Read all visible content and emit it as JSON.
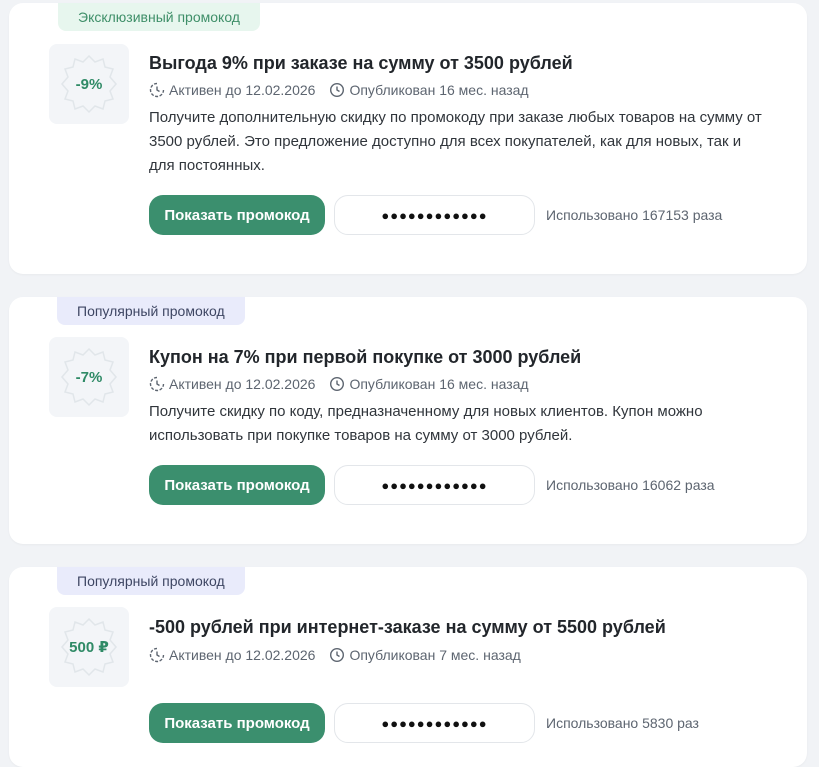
{
  "promos": [
    {
      "badge": "Эксклюзивный промокод",
      "badge_type": "exclusive",
      "discount": "-9%",
      "title": "Выгода 9% при заказе на сумму от 3500 рублей",
      "active": "Активен до 12.02.2026",
      "published": "Опубликован 16 мес. назад",
      "description": "Получите дополнительную скидку по промокоду при заказе любых товаров на сумму от 3500 рублей. Это предложение доступно для всех покупателей, как для новых, так и для постоянных.",
      "button": "Показать промокод",
      "code_mask": "●●●●●●●●●●●●",
      "used": "Использовано 167153 раза"
    },
    {
      "badge": "Популярный промокод",
      "badge_type": "popular",
      "discount": "-7%",
      "title": "Купон на 7% при первой покупке от 3000 рублей",
      "active": "Активен до 12.02.2026",
      "published": "Опубликован 16 мес. назад",
      "description": "Получите скидку по коду, предназначенному для новых клиентов. Купон можно использовать при покупке товаров на сумму от 3000 рублей.",
      "button": "Показать промокод",
      "code_mask": "●●●●●●●●●●●●",
      "used": "Использовано 16062 раза"
    },
    {
      "badge": "Популярный промокод",
      "badge_type": "popular",
      "discount": "500 ₽",
      "title": "-500 рублей при интернет-заказе на сумму от 5500 рублей",
      "active": "Активен до 12.02.2026",
      "published": "Опубликован 7 мес. назад",
      "button": "Показать промокод",
      "code_mask": "●●●●●●●●●●●●",
      "used": "Использовано 5830 раз"
    }
  ],
  "colors": {
    "accent": "#3b8f6e",
    "exclusive_badge_bg": "#e7f6ee",
    "popular_badge_bg": "#e9ebfb"
  },
  "icons": {
    "active": "hourglass-clock-icon",
    "published": "clock-icon",
    "discount": "badge-seal-icon"
  }
}
